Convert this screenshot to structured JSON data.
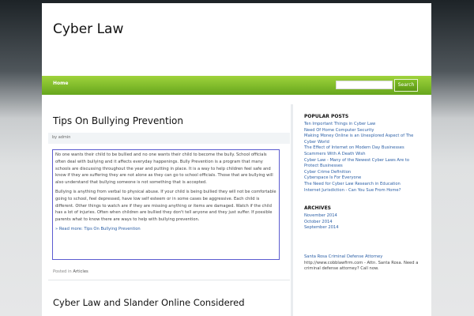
{
  "site": {
    "title": "Cyber Law"
  },
  "nav": {
    "home_label": "Home",
    "search_button_label": "Search",
    "search_placeholder": ""
  },
  "post1": {
    "title": "Tips On Bullying Prevention",
    "byline": "by admin",
    "paragraphs": [
      "No one wants their child to be bullied and no one wants their child to become the bully. School officials often deal with bullying and it affects everyday happenings. Bully Prevention is a program that many schools are discussing throughout the year and putting in place. It is a way to help children feel safe and know if they are suffering they are not alone as they can go to school officials. Those that are bullying will also understand that bullying someone is not something that is accepted.",
      "Bullying is anything from verbal to physical abuse. If your child is being bullied they will not be comfortable going to school, feel depressed, have low self esteem or in some cases be aggressive. Each child is different. Other things to watch are if they are missing anything or items are damaged. Watch if the child has a lot of injuries. Often when children are bullied they don't tell anyone and they just suffer. If possible parents what to know there are ways to help with bullying prevention."
    ],
    "read_more": "» Read more: Tips On Bullying Prevention",
    "posted_in_label": "Posted in",
    "category": "Articles"
  },
  "post2": {
    "title": "Cyber Law and Slander Online Considered"
  },
  "sidebar": {
    "popular_heading": "POPULAR POSTS",
    "popular_posts": [
      "Ten Important Things in Cyber Law",
      "Need Of Home Computer Security",
      "Making Money Online is an Unexplored Aspect of The Cyber World",
      "The Effect of Internet on Modern Day Businesses",
      "Scammers With A Death Wish",
      "Cyber Law - Many of the Newest Cyber Laws Are to Protect Businesses",
      "Cyber Crime Definition",
      "Cyberspace Is For Everyone",
      "The Need for Cyber Law Research in Education",
      "Internet Jurisdiction - Can You Sue From Home?"
    ],
    "archives_heading": "ARCHIVES",
    "archives": [
      "November 2014",
      "October 2014",
      "September 2014"
    ],
    "ad_link": "Santa Rosa Criminal Defense Attorney",
    "ad_text": "http://www.cobblawfirm.com - Attn. Santa Rosa. Need a criminal defense attorney? Call now."
  },
  "colors": {
    "nav_green": "#7ab82a",
    "link_blue": "#2b5fa6",
    "excerpt_border": "#5b5bd0"
  }
}
